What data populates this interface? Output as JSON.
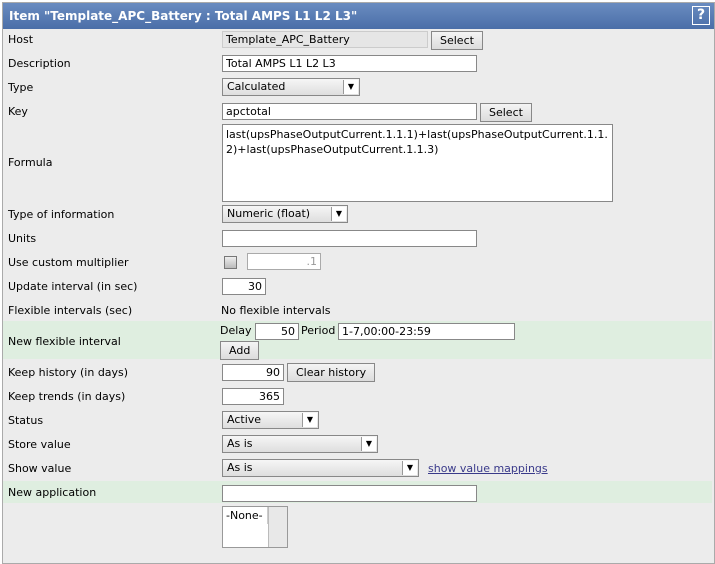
{
  "title": "Item \"Template_APC_Battery : Total AMPS L1 L2 L3\"",
  "help": "?",
  "host": {
    "label": "Host",
    "value": "Template_APC_Battery",
    "button": "Select"
  },
  "description": {
    "label": "Description",
    "value": "Total AMPS L1 L2 L3"
  },
  "type": {
    "label": "Type",
    "value": "Calculated"
  },
  "key": {
    "label": "Key",
    "value": "apctotal",
    "button": "Select"
  },
  "formula": {
    "label": "Formula",
    "value": "last(upsPhaseOutputCurrent.1.1.1)+last(upsPhaseOutputCurrent.1.1.2)+last(upsPhaseOutputCurrent.1.1.3)"
  },
  "type_of_info": {
    "label": "Type of information",
    "value": "Numeric (float)"
  },
  "units": {
    "label": "Units",
    "value": ""
  },
  "multiplier": {
    "label": "Use custom multiplier",
    "value": ".1",
    "checked": false
  },
  "update_interval": {
    "label": "Update interval (in sec)",
    "value": "30"
  },
  "flexible": {
    "label": "Flexible intervals (sec)",
    "value": "No flexible intervals"
  },
  "new_flexible": {
    "label": "New flexible interval",
    "delay_label": "Delay",
    "delay": "50",
    "period_label": "Period",
    "period": "1-7,00:00-23:59",
    "add": "Add"
  },
  "history": {
    "label": "Keep history (in days)",
    "value": "90",
    "button": "Clear history"
  },
  "trends": {
    "label": "Keep trends (in days)",
    "value": "365"
  },
  "status": {
    "label": "Status",
    "value": "Active"
  },
  "store_value": {
    "label": "Store value",
    "value": "As is"
  },
  "show_value": {
    "label": "Show value",
    "value": "As is",
    "link": "show value mappings"
  },
  "new_application": {
    "label": "New application",
    "value": ""
  },
  "applications": {
    "options": [
      "-None-"
    ]
  }
}
